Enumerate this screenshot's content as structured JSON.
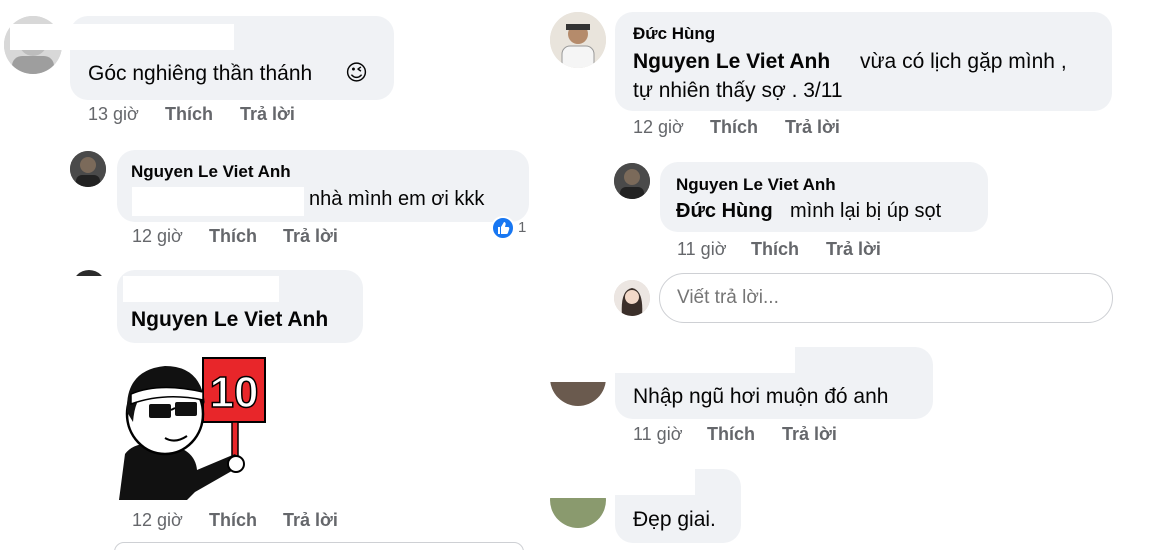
{
  "left_panel": {
    "comment1": {
      "text": "Góc nghiêng thần thánh",
      "emoji": "😉",
      "time": "13 giờ",
      "like": "Thích",
      "reply": "Trả lời"
    },
    "reply1": {
      "name": "Nguyen Le Viet Anh",
      "text": "nhà mình em ơi kkk",
      "time": "12 giờ",
      "like": "Thích",
      "reply": "Trả lời",
      "reaction_count": "1"
    },
    "comment2": {
      "mention": "Nguyen Le Viet Anh",
      "sticker_number": "10",
      "time": "12 giờ",
      "like": "Thích",
      "reply": "Trả lời"
    }
  },
  "right_panel": {
    "comment1": {
      "name": "Đức Hùng",
      "mention": "Nguyen Le Viet Anh",
      "text_line1": "vừa có lịch gặp mình ,",
      "text_line2": "tự nhiên thấy sợ .  3/11",
      "time": "12 giờ",
      "like": "Thích",
      "reply": "Trả lời"
    },
    "reply1": {
      "name": "Nguyen Le Viet Anh",
      "mention": "Đức Hùng",
      "text": "mình lại bị úp sọt",
      "time": "11 giờ",
      "like": "Thích",
      "reply": "Trả lời"
    },
    "reply_input": {
      "placeholder": "Viết trả lời..."
    },
    "comment2": {
      "text": "Nhập ngũ hơi muộn đó anh",
      "time": "11 giờ",
      "like": "Thích",
      "reply": "Trả lời"
    },
    "comment3": {
      "text": "Đẹp giai."
    }
  },
  "colors": {
    "bubble": "#f0f2f5",
    "meta": "#65676b",
    "like_blue": "#1877f2",
    "sticker_red": "#e8262a"
  }
}
